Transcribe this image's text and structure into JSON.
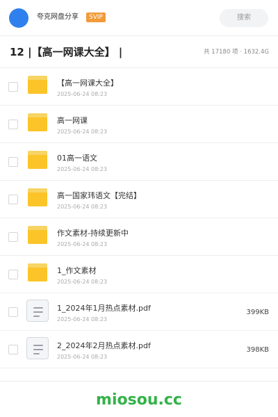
{
  "header": {
    "site_name": "夸克网盘分享",
    "badge": "SVIP",
    "search_label": "搜索"
  },
  "folder": {
    "title": "12 |【高一网课大全】 |",
    "stats": "共 17180 项 · 1632.4G"
  },
  "items": [
    {
      "type": "folder",
      "name": "【高一网课大全】",
      "date": "2025-06-24 08:23",
      "size": ""
    },
    {
      "type": "folder",
      "name": "高一网课",
      "date": "2025-06-24 08:23",
      "size": ""
    },
    {
      "type": "folder",
      "name": "01高一语文",
      "date": "2025-06-24 08:23",
      "size": ""
    },
    {
      "type": "folder",
      "name": "高一国家玮语文【完结】",
      "date": "2025-06-24 08:23",
      "size": ""
    },
    {
      "type": "folder",
      "name": "作文素材-持续更新中",
      "date": "2025-06-24 08:23",
      "size": ""
    },
    {
      "type": "folder",
      "name": "1_作文素材",
      "date": "2025-06-24 08:23",
      "size": ""
    },
    {
      "type": "file",
      "name": "1_2024年1月热点素材.pdf",
      "date": "2025-06-24 08:23",
      "size": "399KB"
    },
    {
      "type": "file",
      "name": "2_2024年2月热点素材.pdf",
      "date": "2025-06-24 08:23",
      "size": "398KB"
    }
  ],
  "icons": {
    "folder": "folder-icon",
    "file": "document-icon"
  },
  "colors": {
    "accent_blue": "#2f80ed",
    "svip_orange": "#f29b38",
    "folder_yellow": "#fbc428",
    "brand_green": "#33b249"
  },
  "footer": {
    "brand": "miosou.cc"
  }
}
